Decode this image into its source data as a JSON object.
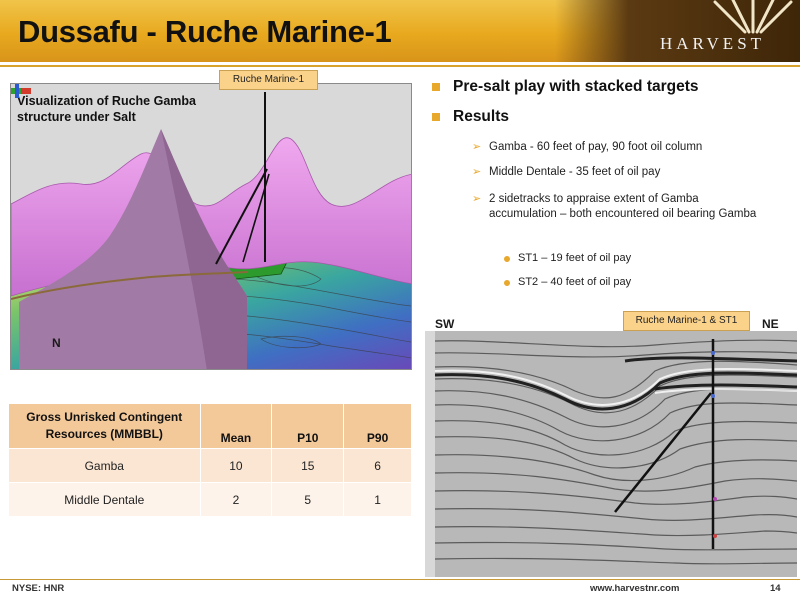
{
  "header": {
    "title": "Dussafu - Ruche Marine-1",
    "logo_text": "HARVEST"
  },
  "visualization": {
    "caption_line1": "Visualization of Ruche Gamba",
    "caption_line2": "structure under Salt",
    "well_label": "Ruche Marine-1",
    "compass_label": "N"
  },
  "bullets": {
    "main": [
      {
        "text": "Pre-salt play with stacked targets"
      },
      {
        "text": "Results"
      }
    ],
    "results": [
      {
        "text": "Gamba - 60 feet of pay, 90 foot oil column"
      },
      {
        "text": "Middle Dentale - 35 feet of oil pay"
      },
      {
        "text": "2 sidetracks to appraise extent of Gamba accumulation – both encountered oil bearing Gamba"
      }
    ],
    "sidetracks": [
      {
        "text": "ST1 – 19 feet of oil pay"
      },
      {
        "text": "ST2 – 40 feet of oil pay"
      }
    ]
  },
  "table": {
    "headers": [
      "Gross Unrisked Contingent Resources  (MMBBL)",
      "Mean",
      "P10",
      "P90"
    ],
    "rows": [
      {
        "name": "Gamba",
        "mean": "10",
        "p10": "15",
        "p90": "6"
      },
      {
        "name": "Middle Dentale",
        "mean": "2",
        "p10": "5",
        "p90": "1"
      }
    ]
  },
  "seismic": {
    "left_label": "SW",
    "right_label": "NE",
    "well_label": "Ruche Marine-1 & ST1"
  },
  "footer": {
    "ticker": "NYSE: HNR",
    "website": "www.harvestnr.com",
    "page_number": "14"
  },
  "colors": {
    "accent": "#e7a82c",
    "header_gold": "#e8a91e",
    "table_header": "#f3c99a",
    "salt_pink": "#e48fe0"
  }
}
